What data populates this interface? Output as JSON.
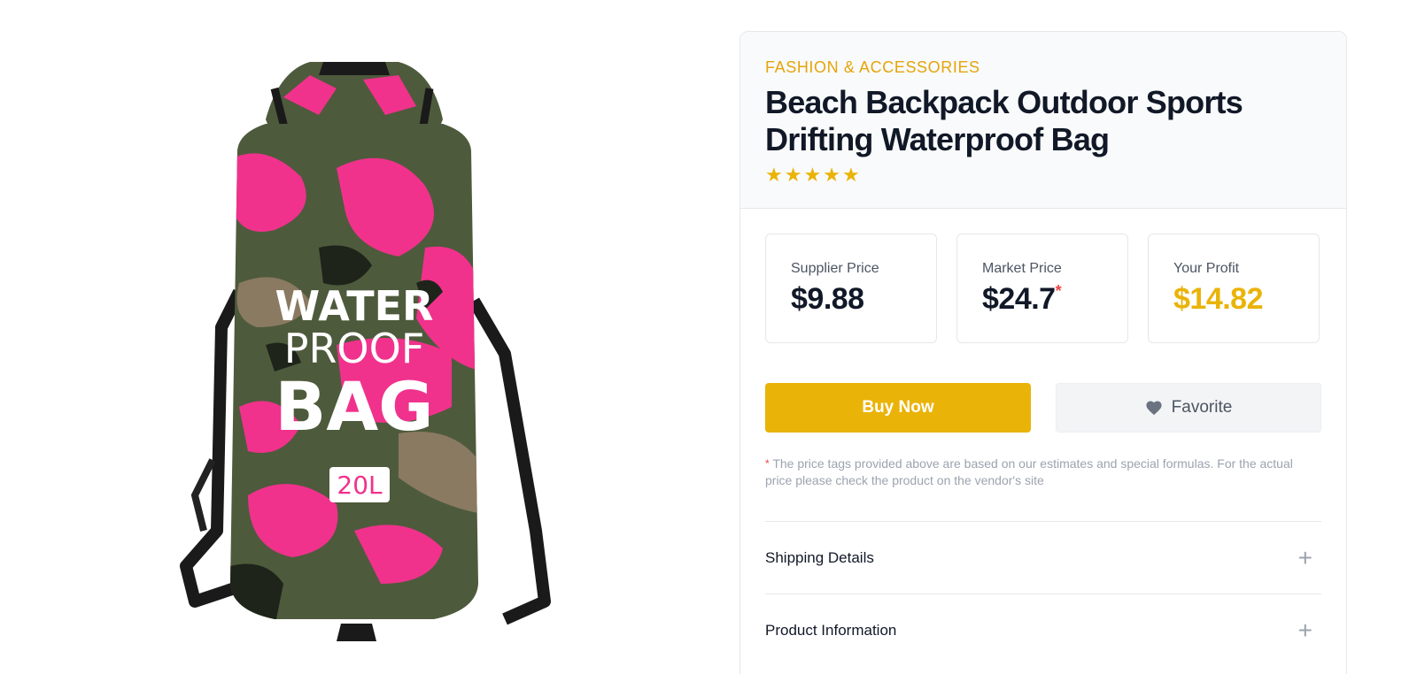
{
  "product": {
    "category": "FASHION & ACCESSORIES",
    "title": "Beach Backpack Outdoor Sports Drifting Waterproof Bag",
    "rating": 5,
    "image": {
      "description": "camo-pink-dry-bag",
      "print_line1": "WATER",
      "print_line2": "PROOF",
      "print_line3": "BAG",
      "capacity": "20L"
    }
  },
  "prices": {
    "supplier": {
      "label": "Supplier Price",
      "value": "$9.88"
    },
    "market": {
      "label": "Market Price",
      "value": "$24.7",
      "marker": "*"
    },
    "profit": {
      "label": "Your Profit",
      "value": "$14.82"
    }
  },
  "actions": {
    "buy_label": "Buy Now",
    "favorite_label": "Favorite",
    "favorite_icon": "heart-icon"
  },
  "disclaimer": {
    "marker": "*",
    "text": "The price tags provided above are based on our estimates and special formulas. For the actual price please check the product on the vendor's site"
  },
  "accordion": [
    {
      "label": "Shipping Details",
      "icon": "plus-icon"
    },
    {
      "label": "Product Information",
      "icon": "plus-icon"
    }
  ],
  "colors": {
    "accent": "#eab308",
    "category": "#e5a50a",
    "asterisk": "#ef4444",
    "camo_pink": "#f0328c",
    "camo_olive": "#4e5a3c",
    "camo_brown": "#8a7a62"
  }
}
